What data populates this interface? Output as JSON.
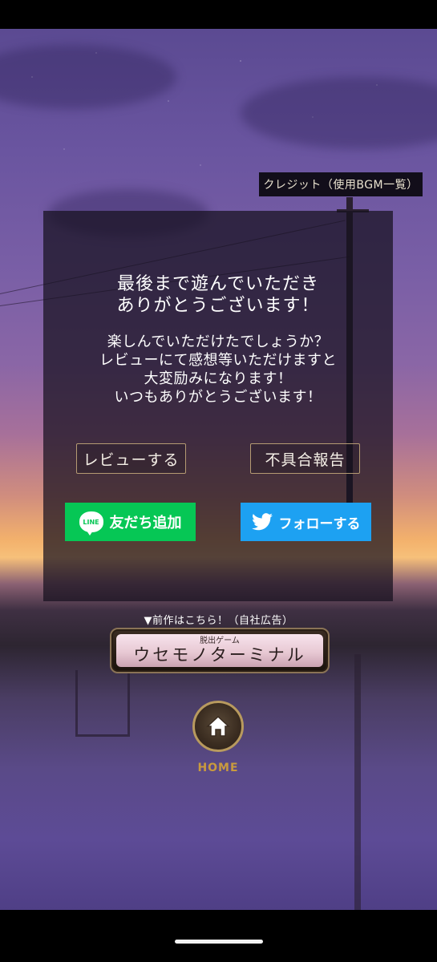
{
  "credit_button": "クレジット（使用BGM一覧）",
  "panel": {
    "thanks": "最後まで遊んでいただき\nありがとうございます！",
    "message": "楽しんでいただけたでしょうか？\nレビューにて感想等いただけますと\n大変励みになります！\nいつもありがとうございます！",
    "review_button": "レビューする",
    "bug_report_button": "不具合報告",
    "line_button": "友だち追加",
    "line_logo": "LINE",
    "twitter_button": "フォローする"
  },
  "ad": {
    "label": "▼前作はこちら！（自社広告）",
    "subtitle": "脱出ゲーム",
    "title": "ウセモノターミナル"
  },
  "home": {
    "label": "HOME"
  },
  "colors": {
    "line_green": "#06c755",
    "twitter_blue": "#1da1f2",
    "home_gold": "#c99a3e"
  }
}
